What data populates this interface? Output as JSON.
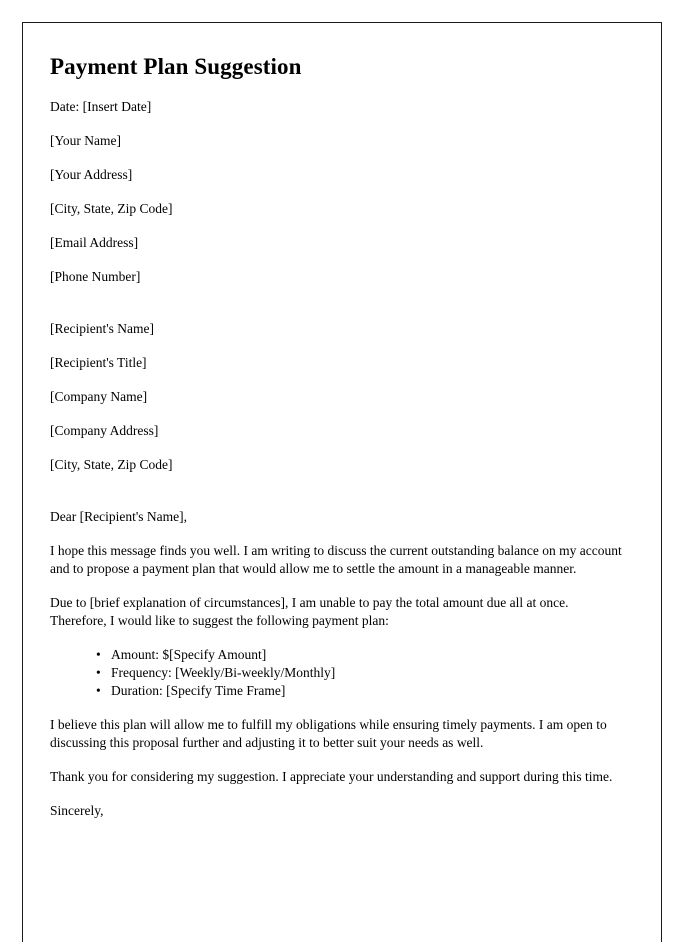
{
  "document": {
    "title": "Payment Plan Suggestion",
    "date_line": "Date: [Insert Date]",
    "sender_block": [
      "[Your Name]",
      "[Your Address]",
      "[City, State, Zip Code]",
      "[Email Address]",
      "[Phone Number]"
    ],
    "recipient_block": [
      "[Recipient's Name]",
      "[Recipient's Title]",
      "[Company Name]",
      "[Company Address]",
      "[City, State, Zip Code]"
    ],
    "salutation": "Dear [Recipient's Name],",
    "paragraphs": [
      "I hope this message finds you well. I am writing to discuss the current outstanding balance on my account and to propose a payment plan that would allow me to settle the amount in a manageable manner.",
      "Due to [brief explanation of circumstances], I am unable to pay the total amount due all at once. Therefore, I would like to suggest the following payment plan:"
    ],
    "plan_items": [
      {
        "bullet": "•",
        "text": "Amount: $[Specify Amount]"
      },
      {
        "bullet": "•",
        "text": "Frequency: [Weekly/Bi-weekly/Monthly]"
      },
      {
        "bullet": "•",
        "text": "Duration: [Specify Time Frame]"
      }
    ],
    "closing_paragraphs": [
      "I believe this plan will allow me to fulfill my obligations while ensuring timely payments. I am open to discussing this proposal further and adjusting it to better suit your needs as well.",
      "Thank you for considering my suggestion. I appreciate your understanding and support during this time."
    ],
    "sign_off": "Sincerely,"
  }
}
